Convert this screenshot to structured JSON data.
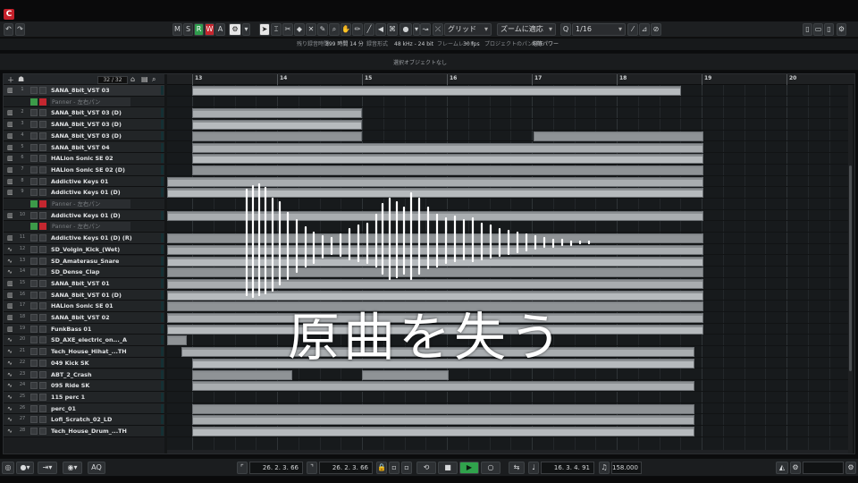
{
  "app": {
    "logo_label": "C"
  },
  "toolbar": {
    "mode_m": "M",
    "mode_s": "S",
    "mode_r": "R",
    "mode_w": "W",
    "mode_a": "A",
    "snap_type": "グリッド",
    "zoom_mode": "ズームに適応",
    "quantize": "1/16"
  },
  "status": {
    "record_time_label": "残り録音時間",
    "record_time": "399 時間 14 分",
    "format_label": "録音形式",
    "format": "48 kHz - 24 bit",
    "framerate_label": "フレームレート",
    "framerate": "30 fps",
    "pan_label": "プロジェクトのパン補正",
    "pan": "均等パワー"
  },
  "infoline": {
    "text": "選択オブジェクトなし"
  },
  "project": {
    "track_count": "32 / 32",
    "bars": [
      "13",
      "14",
      "15",
      "16",
      "17",
      "18",
      "19",
      "20"
    ],
    "tracks": [
      {
        "num": "1",
        "name": "SANA_8bit_VST 03",
        "type": "inst"
      },
      {
        "num": "",
        "name": "Panner - 左右パン",
        "type": "lane"
      },
      {
        "num": "2",
        "name": "SANA_8bit_VST 03 (D)",
        "type": "inst"
      },
      {
        "num": "3",
        "name": "SANA_8bit_VST 03 (D)",
        "type": "inst"
      },
      {
        "num": "4",
        "name": "SANA_8bit_VST 03 (D)",
        "type": "inst"
      },
      {
        "num": "5",
        "name": "SANA_8bit_VST 04",
        "type": "inst"
      },
      {
        "num": "6",
        "name": "HALion Sonic SE 02",
        "type": "inst"
      },
      {
        "num": "7",
        "name": "HALion Sonic SE 02 (D)",
        "type": "inst"
      },
      {
        "num": "8",
        "name": "Addictive Keys 01",
        "type": "inst"
      },
      {
        "num": "9",
        "name": "Addictive Keys 01 (D)",
        "type": "inst"
      },
      {
        "num": "",
        "name": "Panner - 左右パン",
        "type": "lane"
      },
      {
        "num": "10",
        "name": "Addictive Keys 01 (D)",
        "type": "inst"
      },
      {
        "num": "",
        "name": "Panner - 左右パン",
        "type": "lane"
      },
      {
        "num": "11",
        "name": "Addictive Keys 01 (D) (R)",
        "type": "inst"
      },
      {
        "num": "12",
        "name": "SD_Volgin_Kick_(Wet)",
        "type": "audio"
      },
      {
        "num": "13",
        "name": "SD_Amaterasu_Snare",
        "type": "audio"
      },
      {
        "num": "14",
        "name": "SD_Dense_Clap",
        "type": "audio"
      },
      {
        "num": "15",
        "name": "SANA_8bit_VST 01",
        "type": "inst"
      },
      {
        "num": "16",
        "name": "SANA_8bit_VST 01 (D)",
        "type": "inst"
      },
      {
        "num": "17",
        "name": "HALion Sonic SE 01",
        "type": "inst"
      },
      {
        "num": "18",
        "name": "SANA_8bit_VST 02",
        "type": "inst"
      },
      {
        "num": "19",
        "name": "FunkBass 01",
        "type": "inst"
      },
      {
        "num": "20",
        "name": "SD_AXE_electric_on..._A",
        "type": "audio"
      },
      {
        "num": "21",
        "name": "Tech_House_Hihat_...TH",
        "type": "audio"
      },
      {
        "num": "22",
        "name": "049 Kick SK",
        "type": "audio"
      },
      {
        "num": "23",
        "name": "ABT_2_Crash",
        "type": "audio"
      },
      {
        "num": "24",
        "name": "095 Ride SK",
        "type": "audio"
      },
      {
        "num": "25",
        "name": "115 perc 1",
        "type": "audio"
      },
      {
        "num": "26",
        "name": "perc_01",
        "type": "audio"
      },
      {
        "num": "27",
        "name": "Lofi_Scratch_02_LD",
        "type": "audio"
      },
      {
        "num": "28",
        "name": "Tech_House_Drum_...TH",
        "type": "audio"
      }
    ]
  },
  "overlay": {
    "caption": "原曲を失う"
  },
  "transport": {
    "left_locator": "26. 2. 3. 66",
    "right_locator": "26. 2. 3. 66",
    "position": "16. 3. 4. 91",
    "tempo": "158.000",
    "aq_label": "AQ"
  },
  "colors": {
    "accent_record": "#c7262e",
    "accent_play": "#30a24c",
    "monitor": "#2fc9b5"
  }
}
